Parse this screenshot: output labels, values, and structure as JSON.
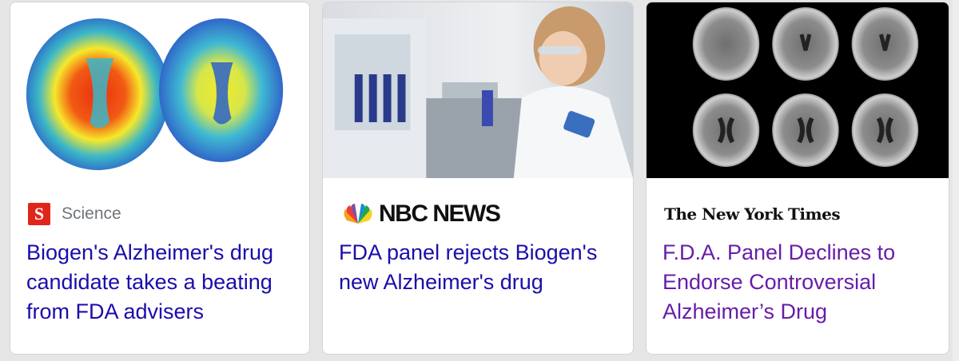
{
  "cards": [
    {
      "source": {
        "name": "Science",
        "logo_text": "S",
        "logo_color": "#e0261b"
      },
      "headline": "Biogen's Alzheimer's drug candidate takes a beating from FDA advisers",
      "headline_color": "#1a0dab",
      "thumbnail": "pet-brain-scan-image"
    },
    {
      "source": {
        "name": "NBC NEWS",
        "logo_icon": "nbc-peacock-icon"
      },
      "headline": "FDA panel rejects Biogen's new Alzheimer's drug",
      "headline_color": "#1a0dab",
      "thumbnail": "lab-scientist-image"
    },
    {
      "source": {
        "name": "The New York Times"
      },
      "headline": "F.D.A. Panel Declines to Endorse Controversial Alzheimer’s Drug",
      "headline_color": "#681da8",
      "thumbnail": "ct-brain-scans-image"
    }
  ]
}
